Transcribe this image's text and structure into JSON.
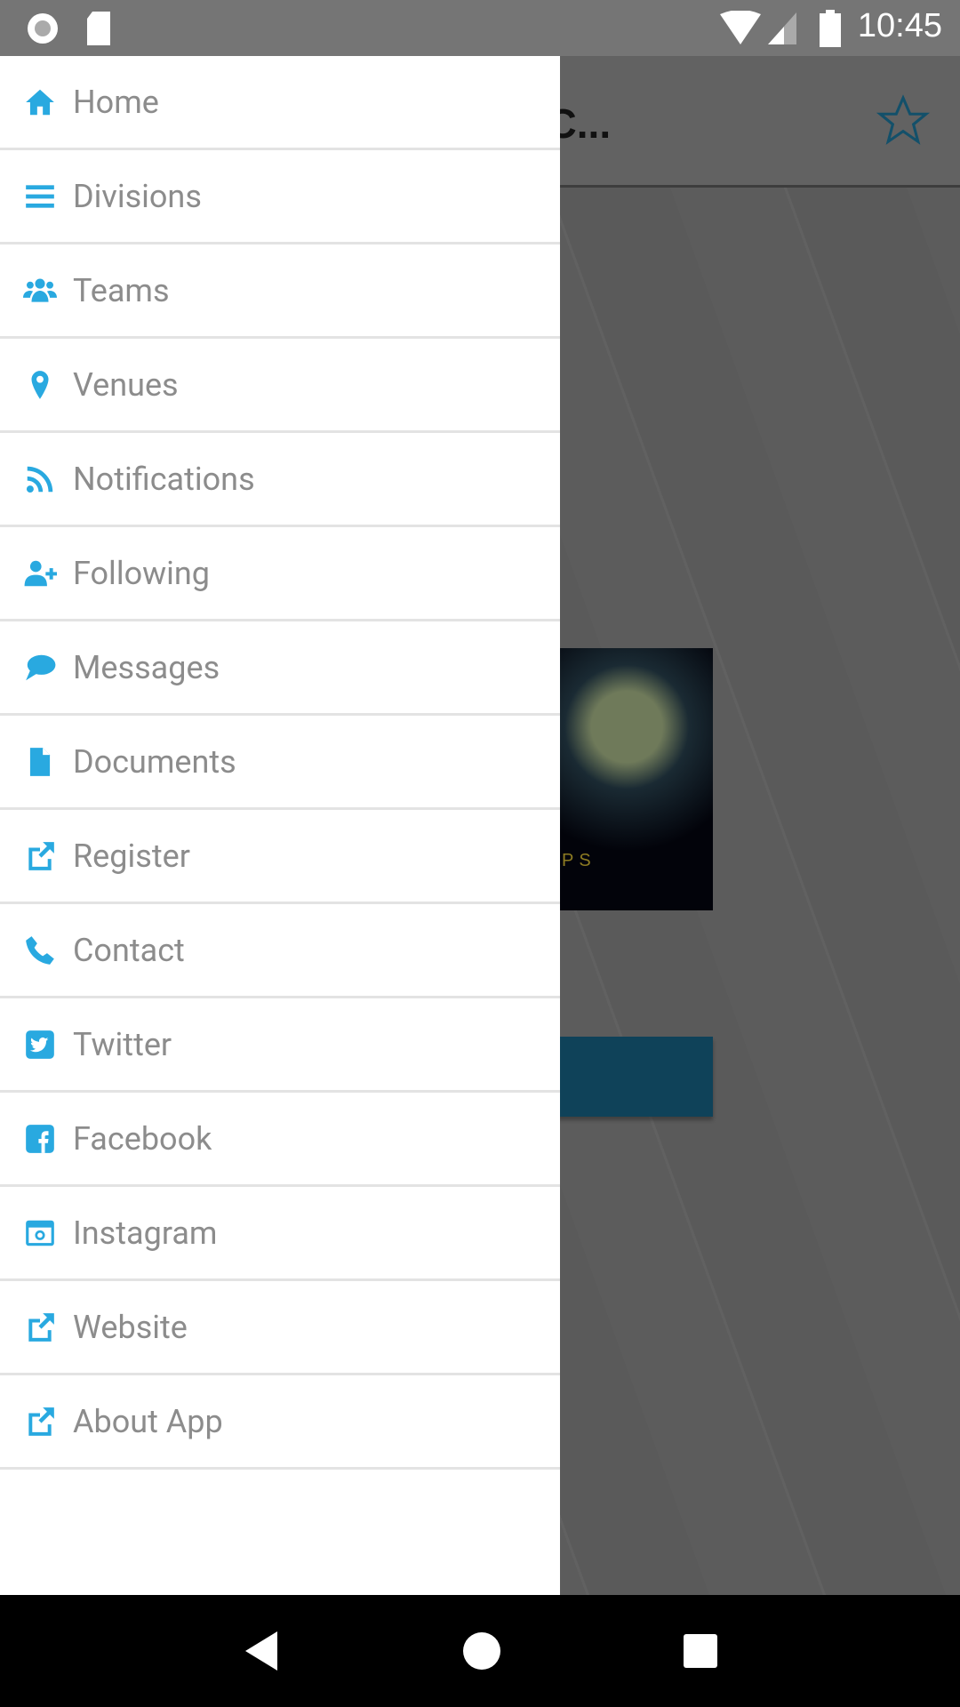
{
  "status_bar": {
    "time": "10:45",
    "icons": [
      "record-icon",
      "sd-card-icon",
      "wifi-icon",
      "signal-icon",
      "battery-icon"
    ]
  },
  "background": {
    "app_title": "ngland Fall C...",
    "favorite_icon": "star-outline-icon",
    "poster_text": "PS"
  },
  "accent_color": "#29a9e0",
  "drawer": {
    "items": [
      {
        "label": "Home",
        "icon": "home-icon"
      },
      {
        "label": "Divisions",
        "icon": "list-icon"
      },
      {
        "label": "Teams",
        "icon": "users-icon"
      },
      {
        "label": "Venues",
        "icon": "map-marker-icon"
      },
      {
        "label": "Notifications",
        "icon": "rss-icon"
      },
      {
        "label": "Following",
        "icon": "user-plus-icon"
      },
      {
        "label": "Messages",
        "icon": "comment-icon"
      },
      {
        "label": "Documents",
        "icon": "file-icon"
      },
      {
        "label": "Register",
        "icon": "external-link-icon"
      },
      {
        "label": "Contact",
        "icon": "phone-icon"
      },
      {
        "label": "Twitter",
        "icon": "twitter-icon"
      },
      {
        "label": "Facebook",
        "icon": "facebook-icon"
      },
      {
        "label": "Instagram",
        "icon": "instagram-icon"
      },
      {
        "label": "Website",
        "icon": "external-link-icon"
      },
      {
        "label": "About App",
        "icon": "external-link-icon"
      }
    ]
  },
  "nav_bar": {
    "buttons": [
      "back",
      "home",
      "recents"
    ]
  }
}
